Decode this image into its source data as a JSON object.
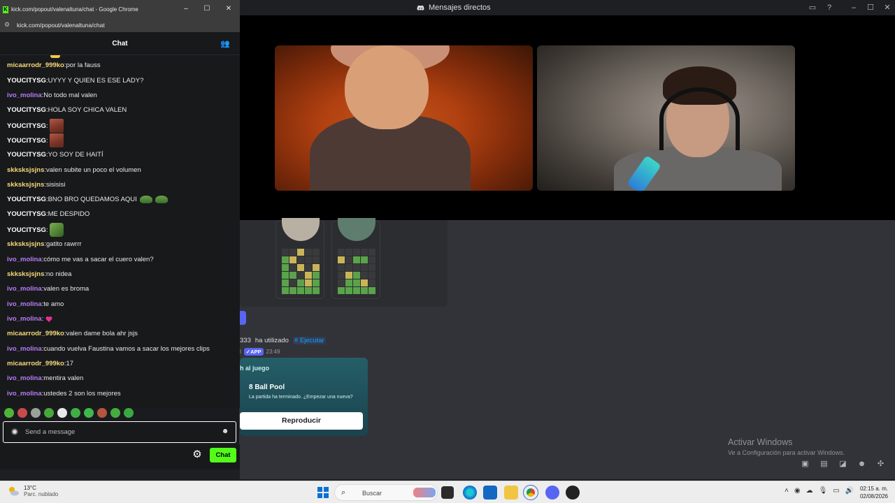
{
  "discord": {
    "window_title": "Mensajes directos",
    "cmd_user": "333",
    "cmd_text": "ha utilizado",
    "cmd_link": "# Ejecutar",
    "app_user": "l",
    "app_badge": "✓APP",
    "app_time": "23:49",
    "activity": {
      "header": "h al juego",
      "title": "8 Ball Pool",
      "subtitle": "La partida ha terminado. ¿Empezar una nueva?",
      "button": "Reproducir"
    },
    "activate_windows": {
      "title": "Activar Windows",
      "subtitle": "Ve a Configuración para activar Windows."
    }
  },
  "chrome": {
    "window_title": "kick.com/popout/valenaltuna/chat - Google Chrome",
    "url": "kick.com/popout/valenaltuna/chat",
    "favicon": "K"
  },
  "chat": {
    "header": "Chat",
    "messages": [
      {
        "user": "micaarrodr_999ko",
        "color": "yellow",
        "text": "por la fauss"
      },
      {
        "user": "YOUCITYSG",
        "color": "white",
        "text": "UYYY Y QUIEN ES ESE LADY?"
      },
      {
        "user": "ivo_molina",
        "color": "purple",
        "text": "No todo mal valen"
      },
      {
        "user": "YOUCITYSG",
        "color": "white",
        "text": "HOLA SOY CHICA VALEN"
      },
      {
        "user": "YOUCITYSG",
        "color": "white",
        "text": ""
      },
      {
        "user": "YOUCITYSG",
        "color": "white",
        "text": ""
      },
      {
        "user": "YOUCITYSG",
        "color": "white",
        "text": "YO SOY DE HAITÍ"
      },
      {
        "user": "skksksjsjns",
        "color": "yellow",
        "text": "valen subite un poco el volumen"
      },
      {
        "user": "skksksjsjns",
        "color": "yellow",
        "text": "sisisisi"
      },
      {
        "user": "YOUCITYSG",
        "color": "white",
        "text": "BNO BRO QUEDAMOS AQUI"
      },
      {
        "user": "YOUCITYSG",
        "color": "white",
        "text": "ME DESPIDO"
      },
      {
        "user": "YOUCITYSG",
        "color": "white",
        "text": ""
      },
      {
        "user": "skksksjsjns",
        "color": "yellow",
        "text": "gatito rawrrr"
      },
      {
        "user": "ivo_molina",
        "color": "purple",
        "text": "cómo me vas a sacar el cuero valen?"
      },
      {
        "user": "skksksjsjns",
        "color": "yellow",
        "text": "no nidea"
      },
      {
        "user": "ivo_molina",
        "color": "purple",
        "text": "valen es broma"
      },
      {
        "user": "ivo_molina",
        "color": "purple",
        "text": "te amo"
      },
      {
        "user": "ivo_molina",
        "color": "purple",
        "text": ""
      },
      {
        "user": "micaarrodr_999ko",
        "color": "yellow",
        "text": "valen dame bola ahr jsjs"
      },
      {
        "user": "ivo_molina",
        "color": "purple",
        "text": "cuando vuelva Faustina vamos a sacar los mejores clips"
      },
      {
        "user": "micaarrodr_999ko",
        "color": "yellow",
        "text": "17"
      },
      {
        "user": "ivo_molina",
        "color": "purple",
        "text": "mentira valen"
      },
      {
        "user": "ivo_molina",
        "color": "purple",
        "text": "ustedes 2 son los mejores"
      }
    ],
    "separator": ": ",
    "input_placeholder": "Send a message",
    "send_label": "Chat"
  },
  "taskbar": {
    "weather_temp": "13°C",
    "weather_desc": "Parc. nublado",
    "search_placeholder": "Buscar",
    "time": "02:15 a. m.",
    "date": "02/08/2026"
  },
  "colors": {
    "kick_green": "#53fc18",
    "user_yellow": "#f5d97a",
    "user_purple": "#b67df5",
    "discord_blurple": "#5865f2"
  }
}
